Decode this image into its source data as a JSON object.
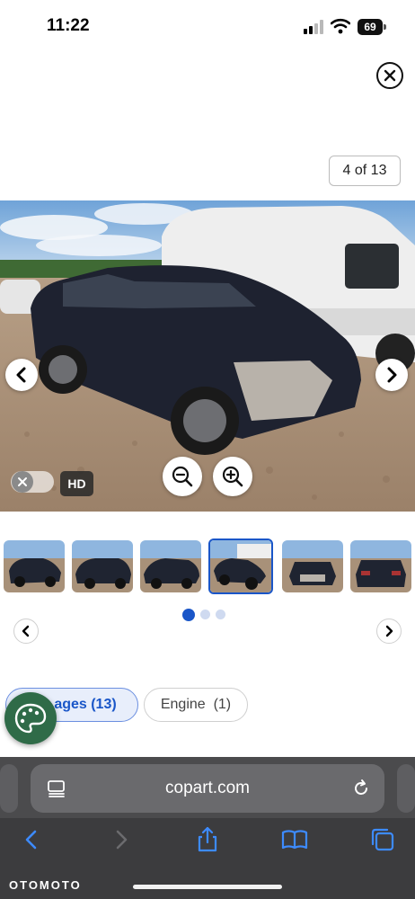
{
  "status_bar": {
    "time": "11:22",
    "battery": "69"
  },
  "viewer": {
    "counter": "4 of 13",
    "hd_badge": "HD"
  },
  "thumbnails": {
    "active_index": 3,
    "pages": 3,
    "active_page": 0
  },
  "tabs": [
    {
      "label": "Images (13)",
      "visible_text": "ages (13)",
      "active": true
    },
    {
      "label": "Engine  (1)",
      "active": false
    }
  ],
  "browser": {
    "url": "copart.com"
  },
  "watermark": "OTOMOTO",
  "colors": {
    "accent": "#1a56c8",
    "palette_button": "#2f6b48",
    "safari_bar": "#4b4b4d"
  }
}
